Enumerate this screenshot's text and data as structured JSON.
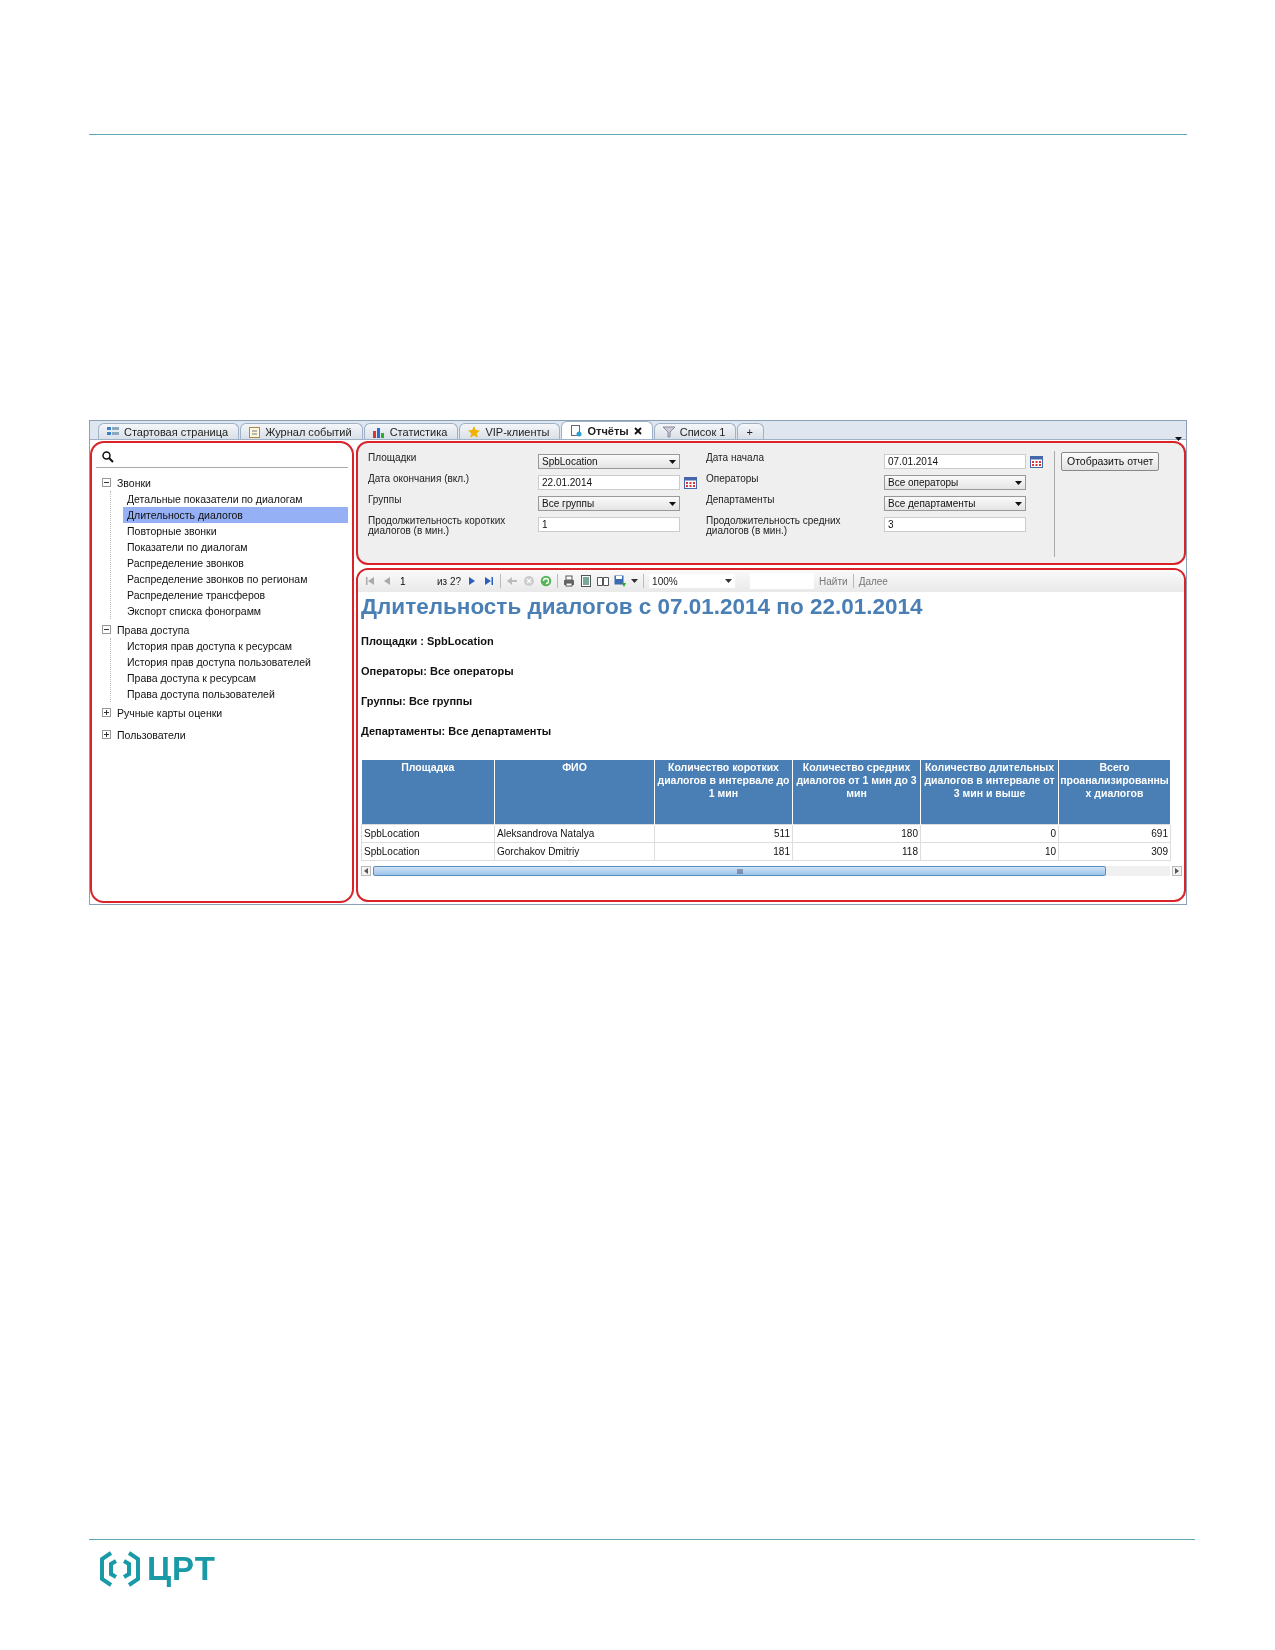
{
  "tabs": [
    {
      "label": "Стартовая страница",
      "kind": "grid",
      "selected": false
    },
    {
      "label": "Журнал событий",
      "kind": "journal",
      "selected": false
    },
    {
      "label": "Статистика",
      "kind": "chart",
      "selected": false
    },
    {
      "label": "VIP-клиенты",
      "kind": "star",
      "selected": false
    },
    {
      "label": "Отчёты",
      "kind": "report",
      "selected": true
    },
    {
      "label": "Список 1",
      "kind": "filter",
      "selected": false
    },
    {
      "label": "+",
      "kind": "plain",
      "selected": false
    }
  ],
  "sidebar": {
    "tree": [
      {
        "label": "Звонки",
        "expanded": true,
        "children": [
          {
            "label": "Детальные показатели по диалогам",
            "selected": false
          },
          {
            "label": "Длительность диалогов",
            "selected": true
          },
          {
            "label": "Повторные звонки",
            "selected": false
          },
          {
            "label": "Показатели по диалогам",
            "selected": false
          },
          {
            "label": "Распределение звонков",
            "selected": false
          },
          {
            "label": "Распределение звонков по регионам",
            "selected": false
          },
          {
            "label": "Распределение трансферов",
            "selected": false
          },
          {
            "label": "Экспорт списка фонограмм",
            "selected": false
          }
        ]
      },
      {
        "label": "Права доступа",
        "expanded": true,
        "children": [
          {
            "label": "История прав доступа к ресурсам",
            "selected": false
          },
          {
            "label": "История прав доступа пользователей",
            "selected": false
          },
          {
            "label": "Права доступа к ресурсам",
            "selected": false
          },
          {
            "label": "Права доступа пользователей",
            "selected": false
          }
        ]
      },
      {
        "label": "Ручные карты оценки",
        "expanded": false
      },
      {
        "label": "Пользователи",
        "expanded": false
      }
    ]
  },
  "filters": {
    "left": [
      {
        "label": "Площадки",
        "kind": "dropdown",
        "value": "SpbLocation"
      },
      {
        "label": "Дата окончания (вкл.)",
        "kind": "date",
        "value": "22.01.2014"
      },
      {
        "label": "Группы",
        "kind": "dropdown",
        "value": "Все группы"
      },
      {
        "label": "Продолжительность коротких диалогов (в мин.)",
        "kind": "text",
        "value": "1"
      }
    ],
    "right": [
      {
        "label": "Дата начала",
        "kind": "date",
        "value": "07.01.2014"
      },
      {
        "label": "Операторы",
        "kind": "dropdown",
        "value": "Все операторы"
      },
      {
        "label": "Департаменты",
        "kind": "dropdown",
        "value": "Все департаменты"
      },
      {
        "label": "Продолжительность средних диалогов (в мин.)",
        "kind": "text",
        "value": "3"
      }
    ],
    "button": "Отобразить отчет"
  },
  "toolbar": {
    "page": "1",
    "page_count": "из 2?",
    "zoom": "100%",
    "find": "Найти",
    "next": "Далее"
  },
  "report": {
    "title": "Длительность диалогов с 07.01.2014 по 22.01.2014",
    "params": [
      "Площадки : SpbLocation",
      "Операторы: Все операторы",
      "Группы: Все группы",
      "Департаменты: Все департаменты"
    ],
    "table": {
      "columns": [
        "Площадка",
        "ФИО",
        "Количество коротких диалогов в интервале до 1 мин",
        "Количество средних диалогов от 1 мин до 3 мин",
        "Количество длительных диалогов в интервале от 3 мин и выше",
        "Всего проанализированных диалогов"
      ],
      "rows": [
        [
          "SpbLocation",
          "Aleksandrova Natalya",
          "511",
          "180",
          "0",
          "691"
        ],
        [
          "SpbLocation",
          "Gorchakov Dmitriy",
          "181",
          "118",
          "10",
          "309"
        ]
      ]
    }
  },
  "footer": {
    "logo": "ЦРТ"
  }
}
